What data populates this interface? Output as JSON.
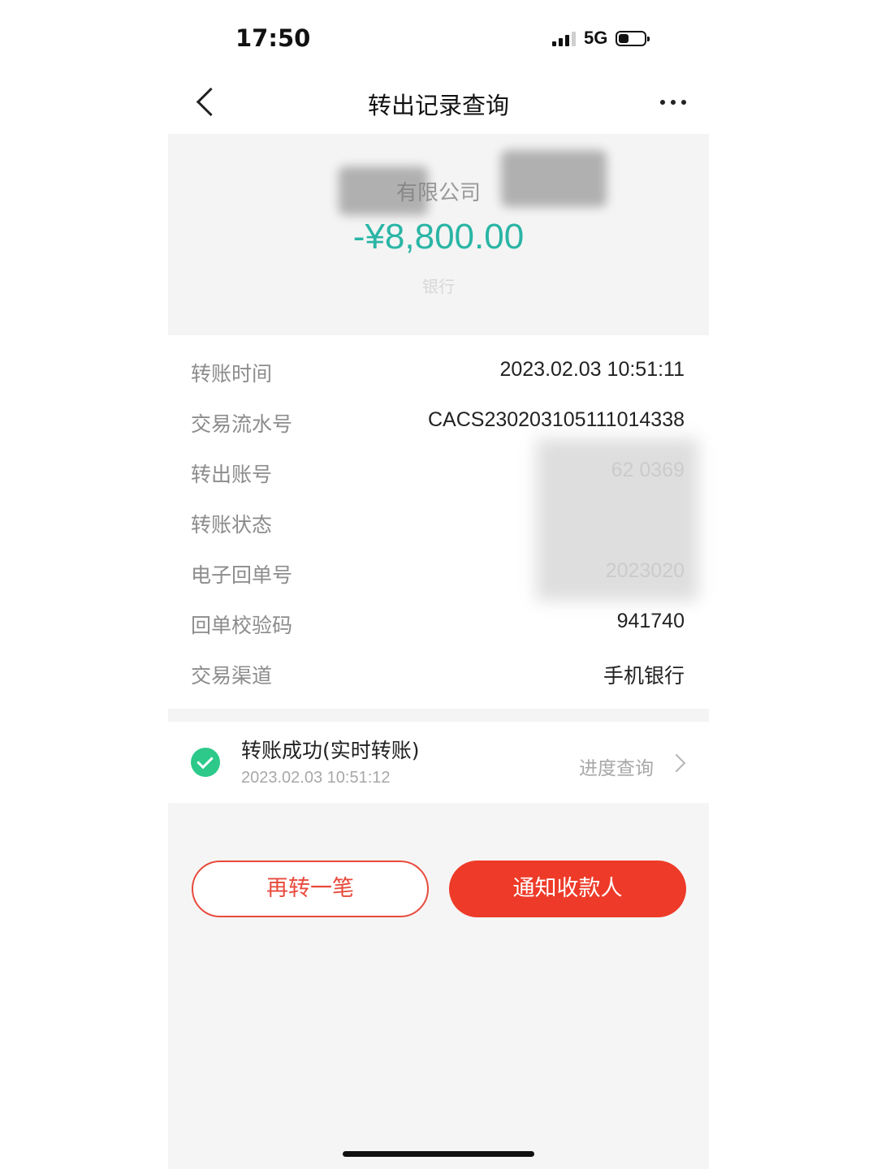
{
  "status_bar": {
    "time": "17:50",
    "network": "5G",
    "signal_bars": 4,
    "signal_active": 3,
    "battery_level": 0.4
  },
  "nav": {
    "title": "转出记录查询",
    "back_icon": "chevron-left-icon",
    "more_icon": "more-dots-icon"
  },
  "header": {
    "payee": "有限公司",
    "amount": "-¥8,800.00",
    "bank": "银行",
    "amount_color": "#2ab5a5"
  },
  "details": [
    {
      "label": "转账时间",
      "value": "2023.02.03 10:51:11"
    },
    {
      "label": "交易流水号",
      "value": "CACS230203105111014338"
    },
    {
      "label": "转出账号",
      "value": "62          0369"
    },
    {
      "label": "转账状态",
      "value": ""
    },
    {
      "label": "电子回单号",
      "value": "2023020"
    },
    {
      "label": "回单校验码",
      "value": "941740"
    },
    {
      "label": "交易渠道",
      "value": "手机银行"
    }
  ],
  "status": {
    "title": "转账成功(实时转账)",
    "time": "2023.02.03 10:51:12",
    "progress_link": "进度查询",
    "check_color": "#2cc98a"
  },
  "actions": {
    "transfer_again": "再转一笔",
    "notify_payee": "通知收款人",
    "accent": "#ee3a28"
  }
}
